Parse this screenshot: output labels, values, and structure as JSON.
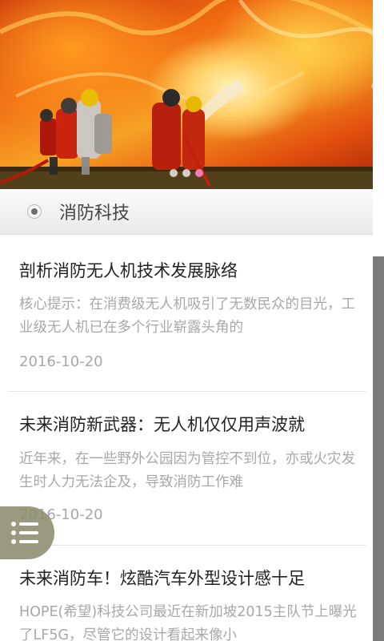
{
  "category": {
    "title": "消防科技"
  },
  "banner": {
    "slides": 3,
    "active_slide": 3
  },
  "articles": [
    {
      "title": "剖析消防无人机技术发展脉络",
      "summary": "核心提示：在消费级无人机吸引了无数民众的目光，工业级无人机已在多个行业崭露头角的",
      "date": "2016-10-20"
    },
    {
      "title": "未来消防新武器：无人机仅仅用声波就",
      "summary": "近年来，在一些野外公园因为管控不到位，亦或火灾发生时人力无法企及，导致消防工作难",
      "date": "2016-10-20"
    },
    {
      "title": "未来消防车！炫酷汽车外型设计感十足",
      "summary": "HOPE(希望)科技公司最近在新加坡2015主队节上曝光了LF5G，尽管它的设计看起来像小",
      "date": ""
    }
  ],
  "icons": {
    "fab": "list-menu-icon",
    "category": "radio-icon"
  }
}
